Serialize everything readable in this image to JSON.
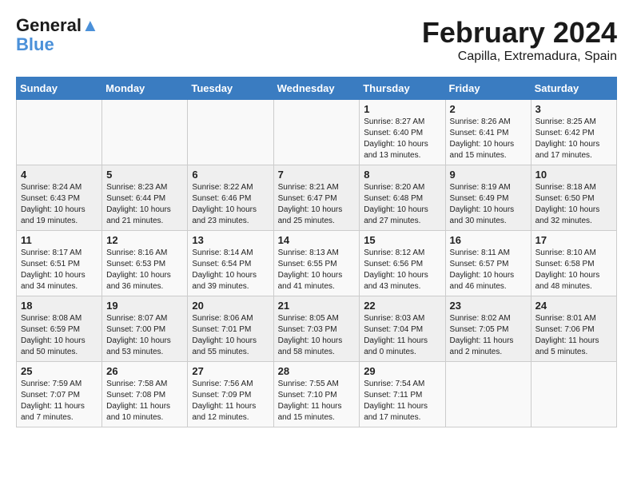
{
  "logo": {
    "line1": "General",
    "line2": "Blue"
  },
  "header": {
    "month": "February 2024",
    "location": "Capilla, Extremadura, Spain"
  },
  "weekdays": [
    "Sunday",
    "Monday",
    "Tuesday",
    "Wednesday",
    "Thursday",
    "Friday",
    "Saturday"
  ],
  "weeks": [
    [
      {
        "day": "",
        "info": ""
      },
      {
        "day": "",
        "info": ""
      },
      {
        "day": "",
        "info": ""
      },
      {
        "day": "",
        "info": ""
      },
      {
        "day": "1",
        "info": "Sunrise: 8:27 AM\nSunset: 6:40 PM\nDaylight: 10 hours\nand 13 minutes."
      },
      {
        "day": "2",
        "info": "Sunrise: 8:26 AM\nSunset: 6:41 PM\nDaylight: 10 hours\nand 15 minutes."
      },
      {
        "day": "3",
        "info": "Sunrise: 8:25 AM\nSunset: 6:42 PM\nDaylight: 10 hours\nand 17 minutes."
      }
    ],
    [
      {
        "day": "4",
        "info": "Sunrise: 8:24 AM\nSunset: 6:43 PM\nDaylight: 10 hours\nand 19 minutes."
      },
      {
        "day": "5",
        "info": "Sunrise: 8:23 AM\nSunset: 6:44 PM\nDaylight: 10 hours\nand 21 minutes."
      },
      {
        "day": "6",
        "info": "Sunrise: 8:22 AM\nSunset: 6:46 PM\nDaylight: 10 hours\nand 23 minutes."
      },
      {
        "day": "7",
        "info": "Sunrise: 8:21 AM\nSunset: 6:47 PM\nDaylight: 10 hours\nand 25 minutes."
      },
      {
        "day": "8",
        "info": "Sunrise: 8:20 AM\nSunset: 6:48 PM\nDaylight: 10 hours\nand 27 minutes."
      },
      {
        "day": "9",
        "info": "Sunrise: 8:19 AM\nSunset: 6:49 PM\nDaylight: 10 hours\nand 30 minutes."
      },
      {
        "day": "10",
        "info": "Sunrise: 8:18 AM\nSunset: 6:50 PM\nDaylight: 10 hours\nand 32 minutes."
      }
    ],
    [
      {
        "day": "11",
        "info": "Sunrise: 8:17 AM\nSunset: 6:51 PM\nDaylight: 10 hours\nand 34 minutes."
      },
      {
        "day": "12",
        "info": "Sunrise: 8:16 AM\nSunset: 6:53 PM\nDaylight: 10 hours\nand 36 minutes."
      },
      {
        "day": "13",
        "info": "Sunrise: 8:14 AM\nSunset: 6:54 PM\nDaylight: 10 hours\nand 39 minutes."
      },
      {
        "day": "14",
        "info": "Sunrise: 8:13 AM\nSunset: 6:55 PM\nDaylight: 10 hours\nand 41 minutes."
      },
      {
        "day": "15",
        "info": "Sunrise: 8:12 AM\nSunset: 6:56 PM\nDaylight: 10 hours\nand 43 minutes."
      },
      {
        "day": "16",
        "info": "Sunrise: 8:11 AM\nSunset: 6:57 PM\nDaylight: 10 hours\nand 46 minutes."
      },
      {
        "day": "17",
        "info": "Sunrise: 8:10 AM\nSunset: 6:58 PM\nDaylight: 10 hours\nand 48 minutes."
      }
    ],
    [
      {
        "day": "18",
        "info": "Sunrise: 8:08 AM\nSunset: 6:59 PM\nDaylight: 10 hours\nand 50 minutes."
      },
      {
        "day": "19",
        "info": "Sunrise: 8:07 AM\nSunset: 7:00 PM\nDaylight: 10 hours\nand 53 minutes."
      },
      {
        "day": "20",
        "info": "Sunrise: 8:06 AM\nSunset: 7:01 PM\nDaylight: 10 hours\nand 55 minutes."
      },
      {
        "day": "21",
        "info": "Sunrise: 8:05 AM\nSunset: 7:03 PM\nDaylight: 10 hours\nand 58 minutes."
      },
      {
        "day": "22",
        "info": "Sunrise: 8:03 AM\nSunset: 7:04 PM\nDaylight: 11 hours\nand 0 minutes."
      },
      {
        "day": "23",
        "info": "Sunrise: 8:02 AM\nSunset: 7:05 PM\nDaylight: 11 hours\nand 2 minutes."
      },
      {
        "day": "24",
        "info": "Sunrise: 8:01 AM\nSunset: 7:06 PM\nDaylight: 11 hours\nand 5 minutes."
      }
    ],
    [
      {
        "day": "25",
        "info": "Sunrise: 7:59 AM\nSunset: 7:07 PM\nDaylight: 11 hours\nand 7 minutes."
      },
      {
        "day": "26",
        "info": "Sunrise: 7:58 AM\nSunset: 7:08 PM\nDaylight: 11 hours\nand 10 minutes."
      },
      {
        "day": "27",
        "info": "Sunrise: 7:56 AM\nSunset: 7:09 PM\nDaylight: 11 hours\nand 12 minutes."
      },
      {
        "day": "28",
        "info": "Sunrise: 7:55 AM\nSunset: 7:10 PM\nDaylight: 11 hours\nand 15 minutes."
      },
      {
        "day": "29",
        "info": "Sunrise: 7:54 AM\nSunset: 7:11 PM\nDaylight: 11 hours\nand 17 minutes."
      },
      {
        "day": "",
        "info": ""
      },
      {
        "day": "",
        "info": ""
      }
    ]
  ]
}
